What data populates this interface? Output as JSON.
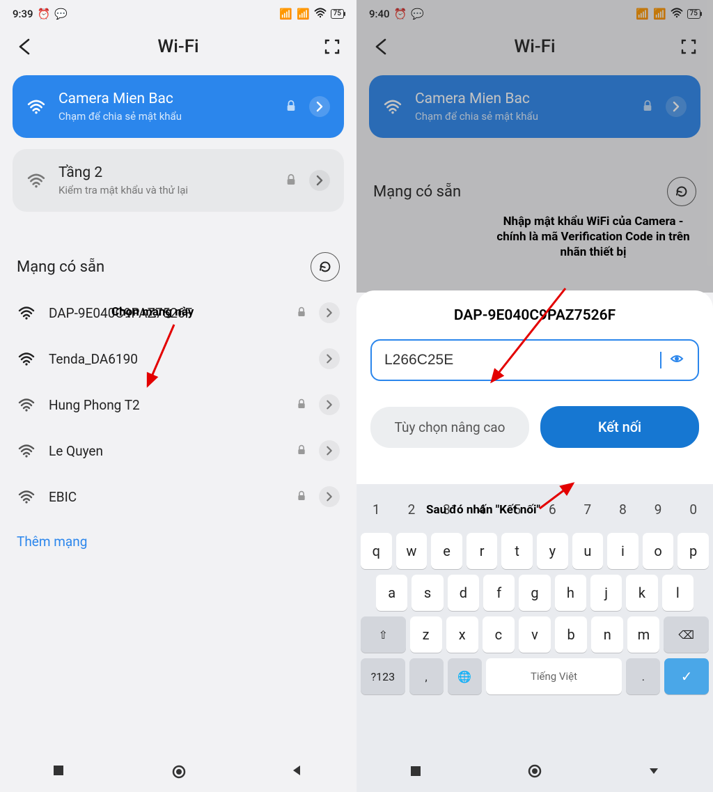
{
  "left": {
    "status": {
      "time": "9:39",
      "battery": "75"
    },
    "header": {
      "title": "Wi-Fi"
    },
    "connected": {
      "name": "Camera Mien Bac",
      "sub": "Chạm để chia sẻ mật khẩu"
    },
    "saved": {
      "name": "Tầng 2",
      "sub": "Kiểm tra mật khẩu và thử lại"
    },
    "annotation1": "Chọn mạng này",
    "section": "Mạng có sẵn",
    "networks": [
      {
        "name": "DAP-9E040C9PAZ7526F",
        "locked": true,
        "strength": "strong"
      },
      {
        "name": "Tenda_DA6190",
        "locked": false,
        "strength": "strong"
      },
      {
        "name": "Hung Phong T2",
        "locked": true,
        "strength": "med"
      },
      {
        "name": "Le Quyen",
        "locked": true,
        "strength": "weak"
      },
      {
        "name": "EBIC",
        "locked": true,
        "strength": "weak"
      }
    ],
    "add": "Thêm mạng"
  },
  "right": {
    "status": {
      "time": "9:40",
      "battery": "75"
    },
    "header": {
      "title": "Wi-Fi"
    },
    "connected": {
      "name": "Camera Mien Bac",
      "sub": "Chạm để chia sẻ mật khẩu"
    },
    "section": "Mạng có sẵn",
    "annotation_top": "Nhập mật khẩu WiFi của Camera - chính là mã Verification Code in trên nhãn thiết bị",
    "annotation_bottom": "Sau đó nhấn \"Kết nối\"",
    "sheet": {
      "title": "DAP-9E040C9PAZ7526F",
      "password": "L266C25E",
      "advanced": "Tùy chọn nâng cao",
      "connect": "Kết nối"
    },
    "keyboard": {
      "space_label": "Tiếng Việt",
      "symbols_label": "?123"
    }
  }
}
